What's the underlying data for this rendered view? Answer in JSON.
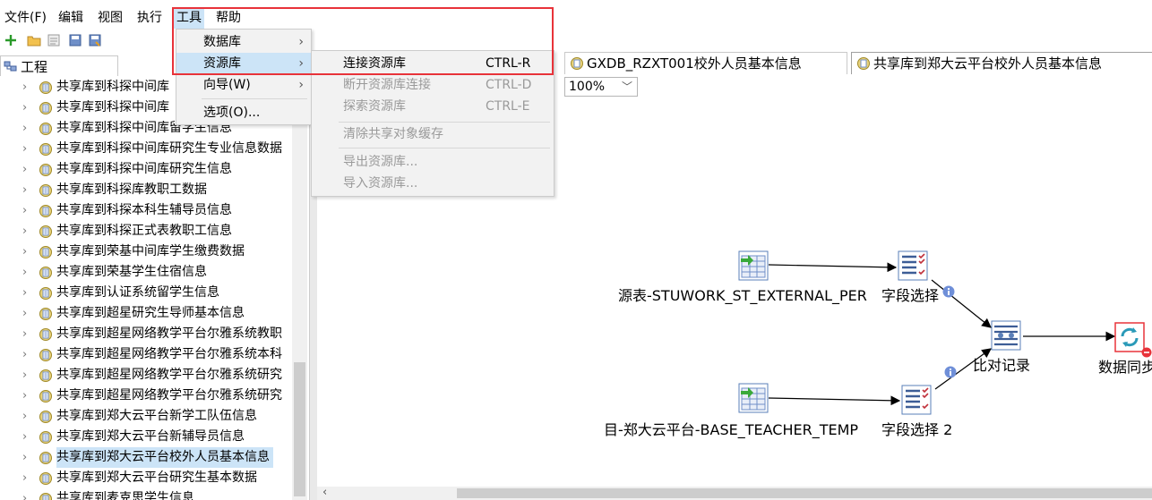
{
  "menubar": {
    "items": [
      {
        "label": "文件(F)"
      },
      {
        "label": "编辑"
      },
      {
        "label": "视图"
      },
      {
        "label": "执行"
      },
      {
        "label": "工具",
        "active": true
      },
      {
        "label": "帮助"
      }
    ]
  },
  "toolbar": {
    "icons": [
      "new-icon",
      "open-folder-icon",
      "explorer-icon",
      "save-icon",
      "save-as-icon"
    ]
  },
  "left_panel": {
    "tab_label": "工程",
    "tree_items": [
      {
        "label": "共享库到科探中间库"
      },
      {
        "label": "共享库到科探中间库"
      },
      {
        "label": "共享库到科探中间库留学生信息"
      },
      {
        "label": "共享库到科探中间库研究生专业信息数据"
      },
      {
        "label": "共享库到科探中间库研究生信息"
      },
      {
        "label": "共享库到科探库教职工数据"
      },
      {
        "label": "共享库到科探本科生辅导员信息"
      },
      {
        "label": "共享库到科探正式表教职工信息"
      },
      {
        "label": "共享库到荣基中间库学生缴费数据"
      },
      {
        "label": "共享库到荣基学生住宿信息"
      },
      {
        "label": "共享库到认证系统留学生信息"
      },
      {
        "label": "共享库到超星研究生导师基本信息"
      },
      {
        "label": "共享库到超星网络教学平台尔雅系统教职"
      },
      {
        "label": "共享库到超星网络教学平台尔雅系统本科"
      },
      {
        "label": "共享库到超星网络教学平台尔雅系统研究"
      },
      {
        "label": "共享库到超星网络教学平台尔雅系统研究"
      },
      {
        "label": "共享库到郑大云平台新学工队伍信息"
      },
      {
        "label": "共享库到郑大云平台新辅导员信息"
      },
      {
        "label": "共享库到郑大云平台校外人员基本信息",
        "selected": true
      },
      {
        "label": "共享库到郑大云平台研究生基本数据"
      },
      {
        "label": "共享库到麦克思学生信息"
      }
    ]
  },
  "doc_tabs": [
    {
      "label": "GXDB_RZXT001校外人员基本信息"
    },
    {
      "label": "共享库到郑大云平台校外人员基本信息",
      "active": true
    }
  ],
  "zoom": {
    "value": "100%"
  },
  "canvas": {
    "steps": [
      {
        "name": "源表-STUWORK_ST_EXTERNAL_PER",
        "icon": "table-input-icon"
      },
      {
        "name": "字段选择",
        "icon": "select-values-icon"
      },
      {
        "name": "比对记录",
        "icon": "merge-rows-icon"
      },
      {
        "name": "数据同步",
        "icon": "synchronize-icon"
      },
      {
        "name": "目-郑大云平台-BASE_TEACHER_TEMP",
        "icon": "table-input-icon"
      },
      {
        "name": "字段选择 2",
        "icon": "select-values-icon"
      }
    ]
  },
  "tools_menu": {
    "items": [
      {
        "label": "数据库",
        "has_submenu": true
      },
      {
        "label": "资源库",
        "has_submenu": true,
        "highlighted": true
      },
      {
        "label": "向导(W)",
        "has_submenu": true
      },
      {
        "label": "选项(O)...",
        "has_submenu": false
      }
    ],
    "submenu_arrow": "›"
  },
  "repository_submenu": {
    "items": [
      {
        "label": "连接资源库",
        "shortcut": "CTRL-R",
        "enabled": true
      },
      {
        "label": "断开资源库连接",
        "shortcut": "CTRL-D",
        "enabled": false
      },
      {
        "label": "探索资源库",
        "shortcut": "CTRL-E",
        "enabled": false
      },
      {
        "label": "清除共享对象缓存",
        "shortcut": "",
        "enabled": false
      },
      {
        "label": "导出资源库...",
        "shortcut": "",
        "enabled": false
      },
      {
        "label": "导入资源库...",
        "shortcut": "",
        "enabled": false
      }
    ]
  },
  "colors": {
    "highlight": "#cce4f7",
    "annotation_red": "#e8333a",
    "info_blue": "#6f8fd8"
  }
}
